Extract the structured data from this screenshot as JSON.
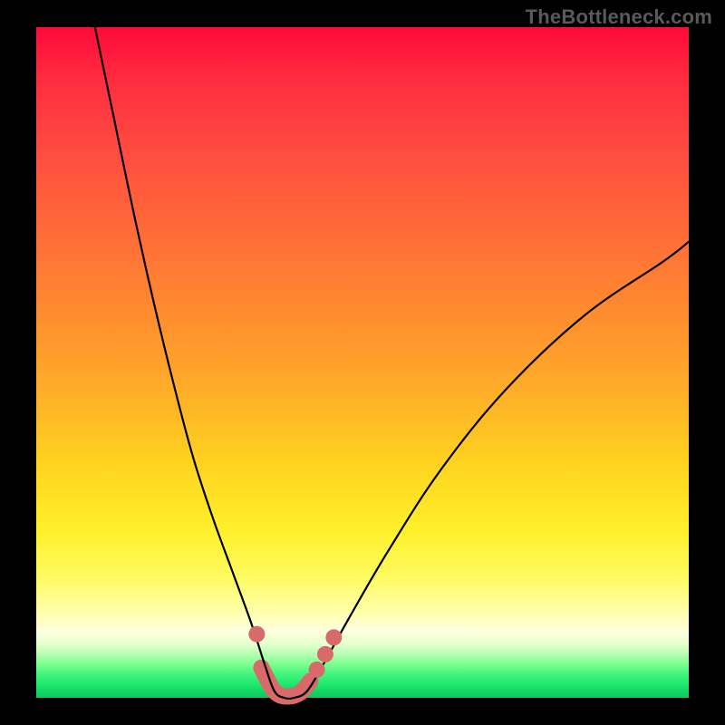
{
  "watermark": "TheBottleneck.com",
  "colors": {
    "curve": "#000000",
    "marker": "#d86a6a",
    "gradient_top": "#ff0a3a",
    "gradient_bottom": "#0fc85f"
  },
  "chart_data": {
    "type": "line",
    "title": "",
    "xlabel": "",
    "ylabel": "",
    "xlim": [
      0,
      100
    ],
    "ylim": [
      0,
      100
    ],
    "grid": false,
    "legend": false,
    "series": [
      {
        "name": "left-branch",
        "x": [
          9,
          12,
          15,
          18,
          21,
          24,
          27,
          30,
          33,
          35,
          36.5
        ],
        "y": [
          100,
          86,
          72,
          59,
          47,
          36,
          27,
          19,
          11,
          5,
          1
        ]
      },
      {
        "name": "right-branch",
        "x": [
          41.5,
          44,
          48,
          54,
          62,
          72,
          84,
          96,
          100
        ],
        "y": [
          1,
          5,
          12,
          22,
          34,
          46,
          57,
          65,
          68
        ]
      },
      {
        "name": "trough",
        "x": [
          36.5,
          38,
          39.5,
          41.5
        ],
        "y": [
          1,
          0,
          0,
          1
        ]
      }
    ],
    "markers": [
      {
        "x": 33.8,
        "y": 9.5
      },
      {
        "x": 43.0,
        "y": 4.2
      },
      {
        "x": 44.3,
        "y": 6.5
      },
      {
        "x": 45.6,
        "y": 9.0
      }
    ],
    "trough_highlight": {
      "x": [
        34.5,
        36.5,
        38.5,
        40.5,
        42.0
      ],
      "y": [
        4.5,
        1.0,
        0.2,
        0.8,
        2.5
      ]
    }
  }
}
